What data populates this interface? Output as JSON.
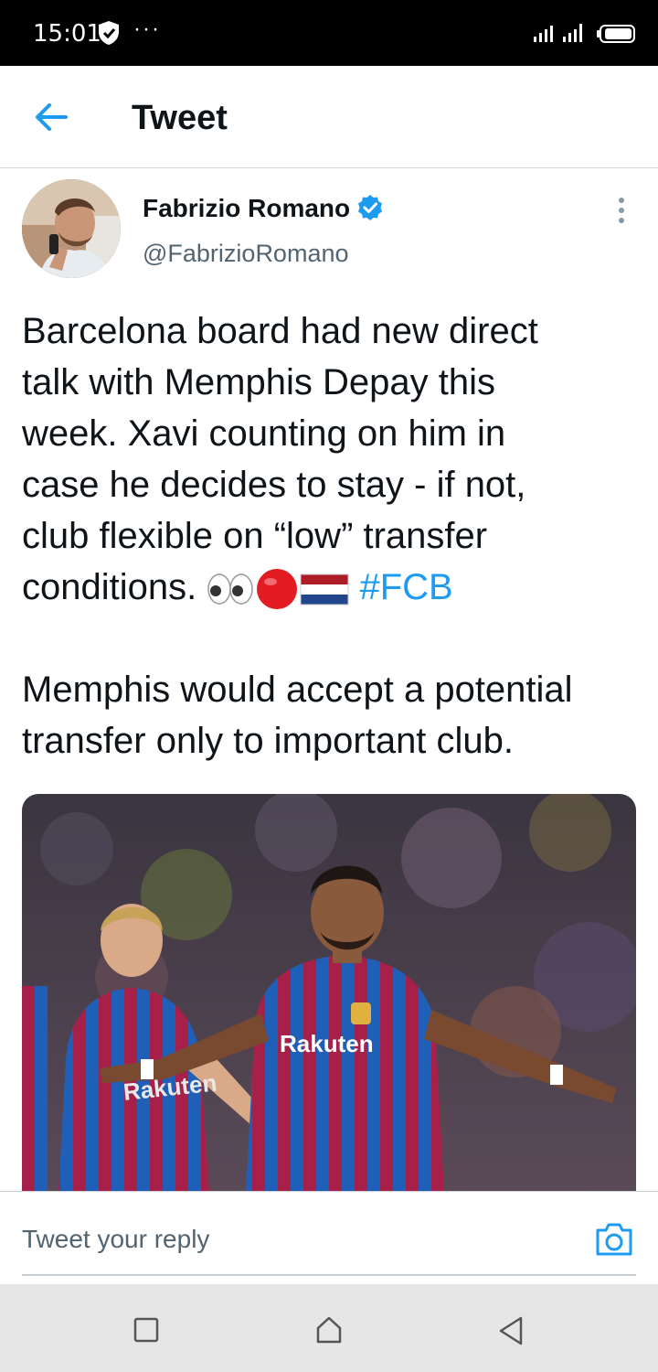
{
  "status_bar": {
    "time": "15:01",
    "dots": "···"
  },
  "header": {
    "title": "Tweet"
  },
  "author": {
    "name": "Fabrizio Romano",
    "handle": "@FabrizioRomano",
    "verified": true
  },
  "tweet": {
    "lines_part1": [
      "Barcelona board had new direct",
      "talk with Memphis Depay this",
      "week. Xavi counting on him in",
      "case he decides to stay - if not,",
      "club flexible on “low” transfer"
    ],
    "last_line_prefix": "conditions.",
    "emojis": [
      "eyes-emoji",
      "red-circle-emoji",
      "netherlands-flag-emoji"
    ],
    "hashtag": "#FCB",
    "lines_part2": [
      "Memphis would accept a potential",
      "transfer only to important club."
    ]
  },
  "media": {
    "description_icon": "photo",
    "shirt_text_main": "Rakuten",
    "shirt_text_side": "Rakuten"
  },
  "reply": {
    "placeholder": "Tweet your reply"
  },
  "colors": {
    "accent": "#1d9bf0",
    "text_primary": "#0f1419",
    "text_secondary": "#536471"
  }
}
